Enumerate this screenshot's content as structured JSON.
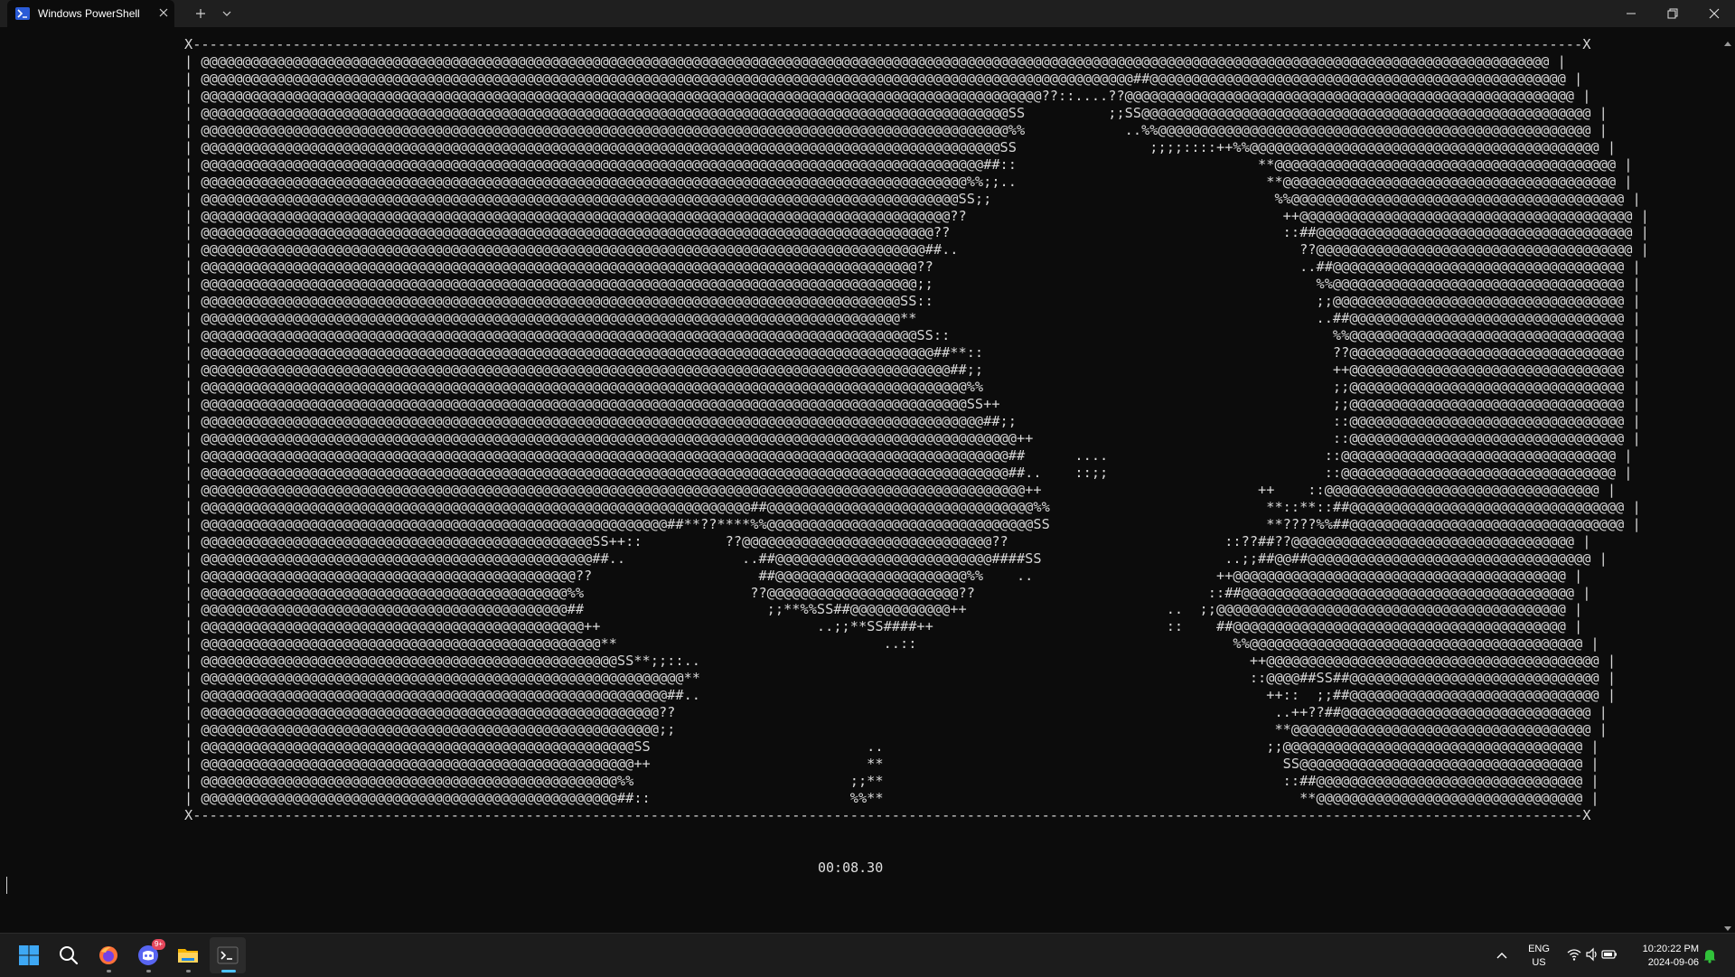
{
  "window": {
    "tab_title": "Windows PowerShell"
  },
  "terminal": {
    "ascii_art": [
      "X-----------------------------------------------------------------------------------------------------------------------------------------------------------------------X",
      "| @@@@@@@@@@@@@@@@@@@@@@@@@@@@@@@@@@@@@@@@@@@@@@@@@@@@@@@@@@@@@@@@@@@@@@@@@@@@@@@@@@@@@@@@@@@@@@@@@@@@@@@@@@@@@@@@@@@@@@@@@@@@@@@@@@@@@@@@@@@@@@@@@@@@@@@@@@@@@@@@@@ |",
      "| @@@@@@@@@@@@@@@@@@@@@@@@@@@@@@@@@@@@@@@@@@@@@@@@@@@@@@@@@@@@@@@@@@@@@@@@@@@@@@@@@@@@@@@@@@@@@@@@@@@@@@@@@@@@@@@@##@@@@@@@@@@@@@@@@@@@@@@@@@@@@@@@@@@@@@@@@@@@@@@@@@@ |",
      "| @@@@@@@@@@@@@@@@@@@@@@@@@@@@@@@@@@@@@@@@@@@@@@@@@@@@@@@@@@@@@@@@@@@@@@@@@@@@@@@@@@@@@@@@@@@@@@@@@@@@@??::....??@@@@@@@@@@@@@@@@@@@@@@@@@@@@@@@@@@@@@@@@@@@@@@@@@@@@@@ |",
      "| @@@@@@@@@@@@@@@@@@@@@@@@@@@@@@@@@@@@@@@@@@@@@@@@@@@@@@@@@@@@@@@@@@@@@@@@@@@@@@@@@@@@@@@@@@@@@@@@@SS          ;;SS@@@@@@@@@@@@@@@@@@@@@@@@@@@@@@@@@@@@@@@@@@@@@@@@@@@@@@ |",
      "| @@@@@@@@@@@@@@@@@@@@@@@@@@@@@@@@@@@@@@@@@@@@@@@@@@@@@@@@@@@@@@@@@@@@@@@@@@@@@@@@@@@@@@@@@@@@@@@@@%%            ..%%@@@@@@@@@@@@@@@@@@@@@@@@@@@@@@@@@@@@@@@@@@@@@@@@@@@@ |",
      "| @@@@@@@@@@@@@@@@@@@@@@@@@@@@@@@@@@@@@@@@@@@@@@@@@@@@@@@@@@@@@@@@@@@@@@@@@@@@@@@@@@@@@@@@@@@@@@@@SS                ;;;;::::++%%@@@@@@@@@@@@@@@@@@@@@@@@@@@@@@@@@@@@@@@@@@ |",
      "| @@@@@@@@@@@@@@@@@@@@@@@@@@@@@@@@@@@@@@@@@@@@@@@@@@@@@@@@@@@@@@@@@@@@@@@@@@@@@@@@@@@@@@@@@@@@@@##::                             **@@@@@@@@@@@@@@@@@@@@@@@@@@@@@@@@@@@@@@@@@ |",
      "| @@@@@@@@@@@@@@@@@@@@@@@@@@@@@@@@@@@@@@@@@@@@@@@@@@@@@@@@@@@@@@@@@@@@@@@@@@@@@@@@@@@@@@@@@@@@%%;;..                              **@@@@@@@@@@@@@@@@@@@@@@@@@@@@@@@@@@@@@@@@ |",
      "| @@@@@@@@@@@@@@@@@@@@@@@@@@@@@@@@@@@@@@@@@@@@@@@@@@@@@@@@@@@@@@@@@@@@@@@@@@@@@@@@@@@@@@@@@@@SS;;                                  %%@@@@@@@@@@@@@@@@@@@@@@@@@@@@@@@@@@@@@@@@ |",
      "| @@@@@@@@@@@@@@@@@@@@@@@@@@@@@@@@@@@@@@@@@@@@@@@@@@@@@@@@@@@@@@@@@@@@@@@@@@@@@@@@@@@@@@@@@@??                                      ++@@@@@@@@@@@@@@@@@@@@@@@@@@@@@@@@@@@@@@@@ |",
      "| @@@@@@@@@@@@@@@@@@@@@@@@@@@@@@@@@@@@@@@@@@@@@@@@@@@@@@@@@@@@@@@@@@@@@@@@@@@@@@@@@@@@@@@@??                                        ::##@@@@@@@@@@@@@@@@@@@@@@@@@@@@@@@@@@@@@@ |",
      "| @@@@@@@@@@@@@@@@@@@@@@@@@@@@@@@@@@@@@@@@@@@@@@@@@@@@@@@@@@@@@@@@@@@@@@@@@@@@@@@@@@@@@@@##..                                         ??@@@@@@@@@@@@@@@@@@@@@@@@@@@@@@@@@@@@@@ |",
      "| @@@@@@@@@@@@@@@@@@@@@@@@@@@@@@@@@@@@@@@@@@@@@@@@@@@@@@@@@@@@@@@@@@@@@@@@@@@@@@@@@@@@@@??                                            ..##@@@@@@@@@@@@@@@@@@@@@@@@@@@@@@@@@@@ |",
      "| @@@@@@@@@@@@@@@@@@@@@@@@@@@@@@@@@@@@@@@@@@@@@@@@@@@@@@@@@@@@@@@@@@@@@@@@@@@@@@@@@@@@@@;;                                              %%@@@@@@@@@@@@@@@@@@@@@@@@@@@@@@@@@@@ |",
      "| @@@@@@@@@@@@@@@@@@@@@@@@@@@@@@@@@@@@@@@@@@@@@@@@@@@@@@@@@@@@@@@@@@@@@@@@@@@@@@@@@@@@SS::                                              ;;@@@@@@@@@@@@@@@@@@@@@@@@@@@@@@@@@@@ |",
      "| @@@@@@@@@@@@@@@@@@@@@@@@@@@@@@@@@@@@@@@@@@@@@@@@@@@@@@@@@@@@@@@@@@@@@@@@@@@@@@@@@@@@**                                                ..##@@@@@@@@@@@@@@@@@@@@@@@@@@@@@@@@@ |",
      "| @@@@@@@@@@@@@@@@@@@@@@@@@@@@@@@@@@@@@@@@@@@@@@@@@@@@@@@@@@@@@@@@@@@@@@@@@@@@@@@@@@@@@@SS::                                              %%@@@@@@@@@@@@@@@@@@@@@@@@@@@@@@@@@ |",
      "| @@@@@@@@@@@@@@@@@@@@@@@@@@@@@@@@@@@@@@@@@@@@@@@@@@@@@@@@@@@@@@@@@@@@@@@@@@@@@@@@@@@@@@@@##**::                                          ??@@@@@@@@@@@@@@@@@@@@@@@@@@@@@@@@@ |",
      "| @@@@@@@@@@@@@@@@@@@@@@@@@@@@@@@@@@@@@@@@@@@@@@@@@@@@@@@@@@@@@@@@@@@@@@@@@@@@@@@@@@@@@@@@@@##;;                                          ++@@@@@@@@@@@@@@@@@@@@@@@@@@@@@@@@@ |",
      "| @@@@@@@@@@@@@@@@@@@@@@@@@@@@@@@@@@@@@@@@@@@@@@@@@@@@@@@@@@@@@@@@@@@@@@@@@@@@@@@@@@@@@@@@@@@@%%                                          ;;@@@@@@@@@@@@@@@@@@@@@@@@@@@@@@@@@ |",
      "| @@@@@@@@@@@@@@@@@@@@@@@@@@@@@@@@@@@@@@@@@@@@@@@@@@@@@@@@@@@@@@@@@@@@@@@@@@@@@@@@@@@@@@@@@@@@SS++                                        ;;@@@@@@@@@@@@@@@@@@@@@@@@@@@@@@@@@ |",
      "| @@@@@@@@@@@@@@@@@@@@@@@@@@@@@@@@@@@@@@@@@@@@@@@@@@@@@@@@@@@@@@@@@@@@@@@@@@@@@@@@@@@@@@@@@@@@@@##;;                                      ::@@@@@@@@@@@@@@@@@@@@@@@@@@@@@@@@@ |",
      "| @@@@@@@@@@@@@@@@@@@@@@@@@@@@@@@@@@@@@@@@@@@@@@@@@@@@@@@@@@@@@@@@@@@@@@@@@@@@@@@@@@@@@@@@@@@@@@@@@@++                                    ::@@@@@@@@@@@@@@@@@@@@@@@@@@@@@@@@@ |",
      "| @@@@@@@@@@@@@@@@@@@@@@@@@@@@@@@@@@@@@@@@@@@@@@@@@@@@@@@@@@@@@@@@@@@@@@@@@@@@@@@@@@@@@@@@@@@@@@@@@##      ....                          ::@@@@@@@@@@@@@@@@@@@@@@@@@@@@@@@@@ |",
      "| @@@@@@@@@@@@@@@@@@@@@@@@@@@@@@@@@@@@@@@@@@@@@@@@@@@@@@@@@@@@@@@@@@@@@@@@@@@@@@@@@@@@@@@@@@@@@@@@@##..    ::;;                          ::@@@@@@@@@@@@@@@@@@@@@@@@@@@@@@@@@ |",
      "| @@@@@@@@@@@@@@@@@@@@@@@@@@@@@@@@@@@@@@@@@@@@@@@@@@@@@@@@@@@@@@@@@@@@@@@@@@@@@@@@@@@@@@@@@@@@@@@@@@@++                          ++    ::@@@@@@@@@@@@@@@@@@@@@@@@@@@@@@@@@ |",
      "| @@@@@@@@@@@@@@@@@@@@@@@@@@@@@@@@@@@@@@@@@@@@@@@@@@@@@@@@@@@@@@@@@@##@@@@@@@@@@@@@@@@@@@@@@@@@@@@@@@@%%                          **::**::##@@@@@@@@@@@@@@@@@@@@@@@@@@@@@@@@@ |",
      "| @@@@@@@@@@@@@@@@@@@@@@@@@@@@@@@@@@@@@@@@@@@@@@@@@@@@@@@@##**??****%%@@@@@@@@@@@@@@@@@@@@@@@@@@@@@@@@SS                          **????%%##@@@@@@@@@@@@@@@@@@@@@@@@@@@@@@@@@ |",
      "| @@@@@@@@@@@@@@@@@@@@@@@@@@@@@@@@@@@@@@@@@@@@@@@SS++::          ??@@@@@@@@@@@@@@@@@@@@@@@@@@@@@@??                          ::??##??@@@@@@@@@@@@@@@@@@@@@@@@@@@@@@@@@@ |",
      "| @@@@@@@@@@@@@@@@@@@@@@@@@@@@@@@@@@@@@@@@@@@@@@@##..              ..##@@@@@@@@@@@@@@@@@@@@@@@@@@####SS                      ..;;##@@##@@@@@@@@@@@@@@@@@@@@@@@@@@@@@@@@@@ |",
      "| @@@@@@@@@@@@@@@@@@@@@@@@@@@@@@@@@@@@@@@@@@@@@??                    ##@@@@@@@@@@@@@@@@@@@@@@@%%    ..                      ++@@@@@@@@@@@@@@@@@@@@@@@@@@@@@@@@@@@@@@@@ |",
      "| @@@@@@@@@@@@@@@@@@@@@@@@@@@@@@@@@@@@@@@@@@@@%%                    ??@@@@@@@@@@@@@@@@@@@@@@@??                            ::##@@@@@@@@@@@@@@@@@@@@@@@@@@@@@@@@@@@@@@@@ |",
      "| @@@@@@@@@@@@@@@@@@@@@@@@@@@@@@@@@@@@@@@@@@@@##                      ;;**%%SS##@@@@@@@@@@@@++                        ..  ;;@@@@@@@@@@@@@@@@@@@@@@@@@@@@@@@@@@@@@@@@@@ |",
      "| @@@@@@@@@@@@@@@@@@@@@@@@@@@@@@@@@@@@@@@@@@@@@@++                          ..;;**SS####++                            ::    ##@@@@@@@@@@@@@@@@@@@@@@@@@@@@@@@@@@@@@@@@ |",
      "| @@@@@@@@@@@@@@@@@@@@@@@@@@@@@@@@@@@@@@@@@@@@@@@@**                                ..::                                      %%@@@@@@@@@@@@@@@@@@@@@@@@@@@@@@@@@@@@@@@@ |",
      "| @@@@@@@@@@@@@@@@@@@@@@@@@@@@@@@@@@@@@@@@@@@@@@@@@@SS**;;::..                                                                  ++@@@@@@@@@@@@@@@@@@@@@@@@@@@@@@@@@@@@@@@@ |",
      "| @@@@@@@@@@@@@@@@@@@@@@@@@@@@@@@@@@@@@@@@@@@@@@@@@@@@@@@@@@**                                                                  ::@@@@##SS##@@@@@@@@@@@@@@@@@@@@@@@@@@@@@@ |",
      "| @@@@@@@@@@@@@@@@@@@@@@@@@@@@@@@@@@@@@@@@@@@@@@@@@@@@@@@@##..                                                                    ++::  ;;##@@@@@@@@@@@@@@@@@@@@@@@@@@@@@@ |",
      "| @@@@@@@@@@@@@@@@@@@@@@@@@@@@@@@@@@@@@@@@@@@@@@@@@@@@@@@??                                                                        ..++??##@@@@@@@@@@@@@@@@@@@@@@@@@@@@@@ |",
      "| @@@@@@@@@@@@@@@@@@@@@@@@@@@@@@@@@@@@@@@@@@@@@@@@@@@@@@@;;                                                                        **@@@@@@@@@@@@@@@@@@@@@@@@@@@@@@@@@@@@ |",
      "| @@@@@@@@@@@@@@@@@@@@@@@@@@@@@@@@@@@@@@@@@@@@@@@@@@@@SS                          ..                                              ;;@@@@@@@@@@@@@@@@@@@@@@@@@@@@@@@@@@@@ |",
      "| @@@@@@@@@@@@@@@@@@@@@@@@@@@@@@@@@@@@@@@@@@@@@@@@@@@@++                          **                                                SS@@@@@@@@@@@@@@@@@@@@@@@@@@@@@@@@@@ |",
      "| @@@@@@@@@@@@@@@@@@@@@@@@@@@@@@@@@@@@@@@@@@@@@@@@@@%%                          ;;**                                                ::##@@@@@@@@@@@@@@@@@@@@@@@@@@@@@@@@ |",
      "| @@@@@@@@@@@@@@@@@@@@@@@@@@@@@@@@@@@@@@@@@@@@@@@@@@##::                        %%**                                                  **@@@@@@@@@@@@@@@@@@@@@@@@@@@@@@@@ |",
      "X-----------------------------------------------------------------------------------------------------------------------------------------------------------------------X"
    ],
    "timer": "00:08.30"
  },
  "taskbar": {
    "discord_badge": "9+",
    "lang_top": "ENG",
    "lang_bottom": "US",
    "time": "10:20:22 PM",
    "date": "2024-09-06",
    "active_color": "#4cc2ff",
    "icons": [
      "windows-start-icon",
      "search-icon",
      "firefox-icon",
      "discord-icon",
      "file-explorer-icon",
      "terminal-icon"
    ]
  }
}
